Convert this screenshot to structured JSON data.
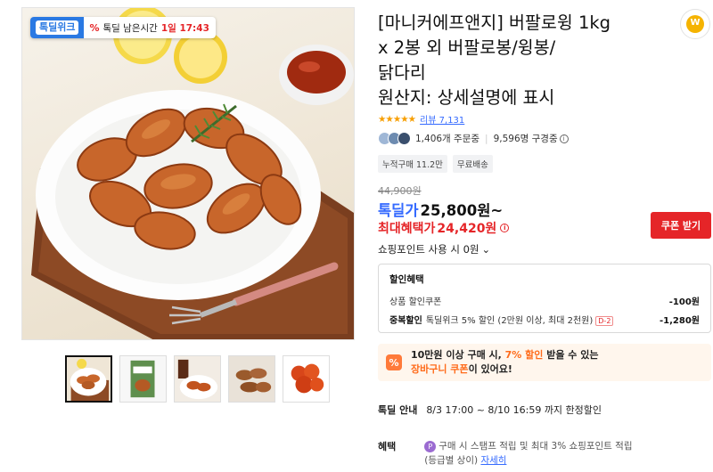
{
  "gallery": {
    "deal_logo": "톡딜위크",
    "deal_timer_label": "톡딜 남은시간",
    "deal_time": "1일 17:43",
    "thumbnail_count": 5
  },
  "product": {
    "title_lines": [
      "[마니커에프앤지] 버팔로윙 1kg",
      "x 2봉 외 버팔로봉/윙봉/",
      "닭다리",
      "원산지: 상세설명에 표시"
    ],
    "rating": 4.8,
    "review_text": "리뷰 7,131",
    "orders": "1,406개 주문중",
    "subscribers": "9,596명 구경중",
    "tags": [
      "누적구매 11.2만",
      "무료배송"
    ]
  },
  "price": {
    "original": "44,900원",
    "deal_label": "톡딜가",
    "deal_value": "25,800원~",
    "max_label": "최대혜택가",
    "max_value": "24,420원",
    "coupon_button": "쿠폰 받기",
    "points_label": "쇼핑포인트 사용 시 0원"
  },
  "discount": {
    "heading": "할인혜택",
    "rows": [
      {
        "lead": "",
        "label": "상품 할인쿠폰",
        "tag": "",
        "amount": "-100원"
      },
      {
        "lead": "중복할인",
        "label": "톡딜위크 5% 할인 (2만원 이상, 최대 2천원)",
        "tag": "D-2",
        "amount": "-1,280원"
      }
    ]
  },
  "promo": {
    "line1_a": "10만원 이상 구매 시, ",
    "line1_hl": "7% 할인",
    "line1_b": " 받을 수 있는",
    "line2_hl": "장바구니 쿠폰",
    "line2_b": "이 있어요!"
  },
  "deal_info": {
    "label": "톡딜 안내",
    "value": "8/3 17:00 ~ 8/10 16:59 까지 한정할인"
  },
  "benefit": {
    "label": "혜택",
    "line1": "구매 시 스탬프 적립 및 최대 3% 쇼핑포인트 적립",
    "line2": "(등급별 상이)",
    "link": "자세히"
  },
  "colors": {
    "accent_blue": "#346aff",
    "deal_red": "#e52528",
    "promo_orange": "#ff6b1a",
    "star": "#f79e00"
  }
}
